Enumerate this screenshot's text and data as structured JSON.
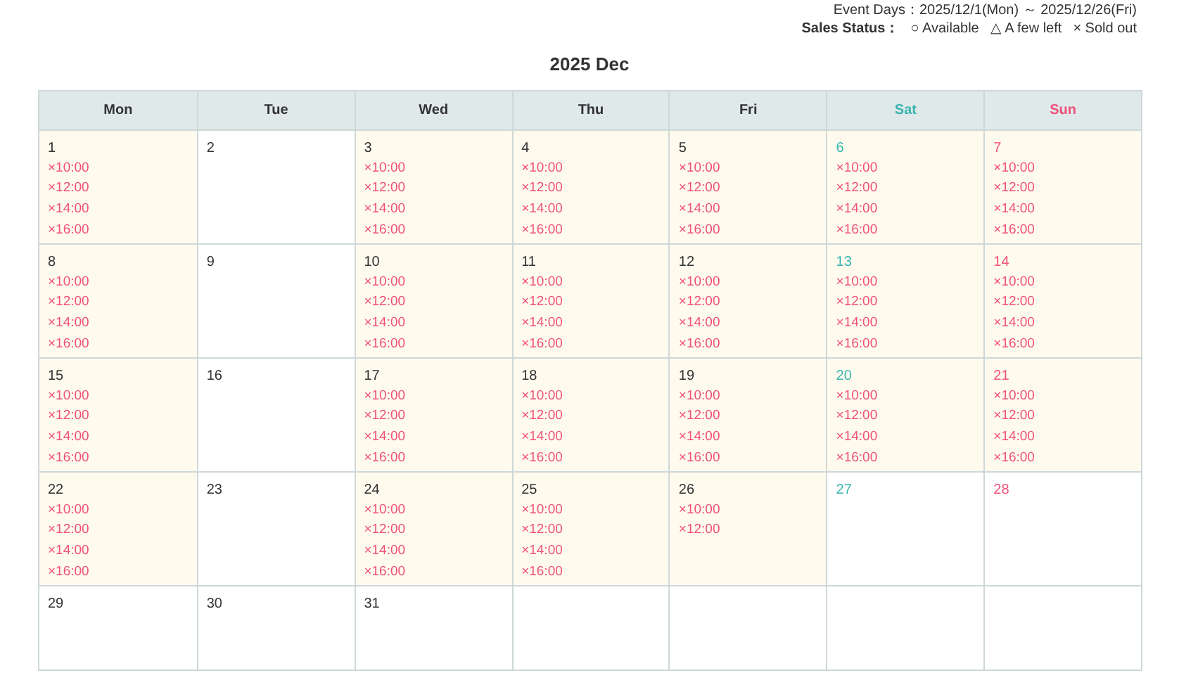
{
  "event_days": "Event Days：2025/12/1(Mon) ～ 2025/12/26(Fri)",
  "legend": {
    "label": "Sales Status：",
    "items": [
      "○ Available",
      "△ A few left",
      "× Sold out"
    ]
  },
  "title": "2025 Dec",
  "columns": [
    {
      "label": "Mon",
      "kind": "weekday"
    },
    {
      "label": "Tue",
      "kind": "weekday"
    },
    {
      "label": "Wed",
      "kind": "weekday"
    },
    {
      "label": "Thu",
      "kind": "weekday"
    },
    {
      "label": "Fri",
      "kind": "weekday"
    },
    {
      "label": "Sat",
      "kind": "sat"
    },
    {
      "label": "Sun",
      "kind": "sun"
    }
  ],
  "weeks": [
    [
      {
        "day": "1",
        "kind": "event",
        "slots": [
          "×10:00",
          "×12:00",
          "×14:00",
          "×16:00"
        ]
      },
      {
        "day": "2",
        "kind": "plain"
      },
      {
        "day": "3",
        "kind": "event",
        "slots": [
          "×10:00",
          "×12:00",
          "×14:00",
          "×16:00"
        ]
      },
      {
        "day": "4",
        "kind": "event",
        "slots": [
          "×10:00",
          "×12:00",
          "×14:00",
          "×16:00"
        ]
      },
      {
        "day": "5",
        "kind": "event",
        "slots": [
          "×10:00",
          "×12:00",
          "×14:00",
          "×16:00"
        ]
      },
      {
        "day": "6",
        "kind": "event",
        "slots": [
          "×10:00",
          "×12:00",
          "×14:00",
          "×16:00"
        ]
      },
      {
        "day": "7",
        "kind": "event",
        "slots": [
          "×10:00",
          "×12:00",
          "×14:00",
          "×16:00"
        ]
      }
    ],
    [
      {
        "day": "8",
        "kind": "event",
        "slots": [
          "×10:00",
          "×12:00",
          "×14:00",
          "×16:00"
        ]
      },
      {
        "day": "9",
        "kind": "plain"
      },
      {
        "day": "10",
        "kind": "event",
        "slots": [
          "×10:00",
          "×12:00",
          "×14:00",
          "×16:00"
        ]
      },
      {
        "day": "11",
        "kind": "event",
        "slots": [
          "×10:00",
          "×12:00",
          "×14:00",
          "×16:00"
        ]
      },
      {
        "day": "12",
        "kind": "event",
        "slots": [
          "×10:00",
          "×12:00",
          "×14:00",
          "×16:00"
        ]
      },
      {
        "day": "13",
        "kind": "event",
        "slots": [
          "×10:00",
          "×12:00",
          "×14:00",
          "×16:00"
        ]
      },
      {
        "day": "14",
        "kind": "event",
        "slots": [
          "×10:00",
          "×12:00",
          "×14:00",
          "×16:00"
        ]
      }
    ],
    [
      {
        "day": "15",
        "kind": "event",
        "slots": [
          "×10:00",
          "×12:00",
          "×14:00",
          "×16:00"
        ]
      },
      {
        "day": "16",
        "kind": "plain"
      },
      {
        "day": "17",
        "kind": "event",
        "slots": [
          "×10:00",
          "×12:00",
          "×14:00",
          "×16:00"
        ]
      },
      {
        "day": "18",
        "kind": "event",
        "slots": [
          "×10:00",
          "×12:00",
          "×14:00",
          "×16:00"
        ]
      },
      {
        "day": "19",
        "kind": "event",
        "slots": [
          "×10:00",
          "×12:00",
          "×14:00",
          "×16:00"
        ]
      },
      {
        "day": "20",
        "kind": "event",
        "slots": [
          "×10:00",
          "×12:00",
          "×14:00",
          "×16:00"
        ]
      },
      {
        "day": "21",
        "kind": "event",
        "slots": [
          "×10:00",
          "×12:00",
          "×14:00",
          "×16:00"
        ]
      }
    ],
    [
      {
        "day": "22",
        "kind": "event",
        "slots": [
          "×10:00",
          "×12:00",
          "×14:00",
          "×16:00"
        ]
      },
      {
        "day": "23",
        "kind": "plain"
      },
      {
        "day": "24",
        "kind": "event",
        "slots": [
          "×10:00",
          "×12:00",
          "×14:00",
          "×16:00"
        ]
      },
      {
        "day": "25",
        "kind": "event",
        "slots": [
          "×10:00",
          "×12:00",
          "×14:00",
          "×16:00"
        ]
      },
      {
        "day": "26",
        "kind": "event",
        "slots": [
          "×10:00",
          "×12:00"
        ]
      },
      {
        "day": "27",
        "kind": "plain"
      },
      {
        "day": "28",
        "kind": "plain"
      }
    ],
    [
      {
        "day": "29",
        "kind": "plain"
      },
      {
        "day": "30",
        "kind": "plain"
      },
      {
        "day": "31",
        "kind": "plain"
      },
      {
        "kind": "empty"
      },
      {
        "kind": "empty"
      },
      {
        "kind": "empty"
      },
      {
        "kind": "empty"
      }
    ]
  ]
}
